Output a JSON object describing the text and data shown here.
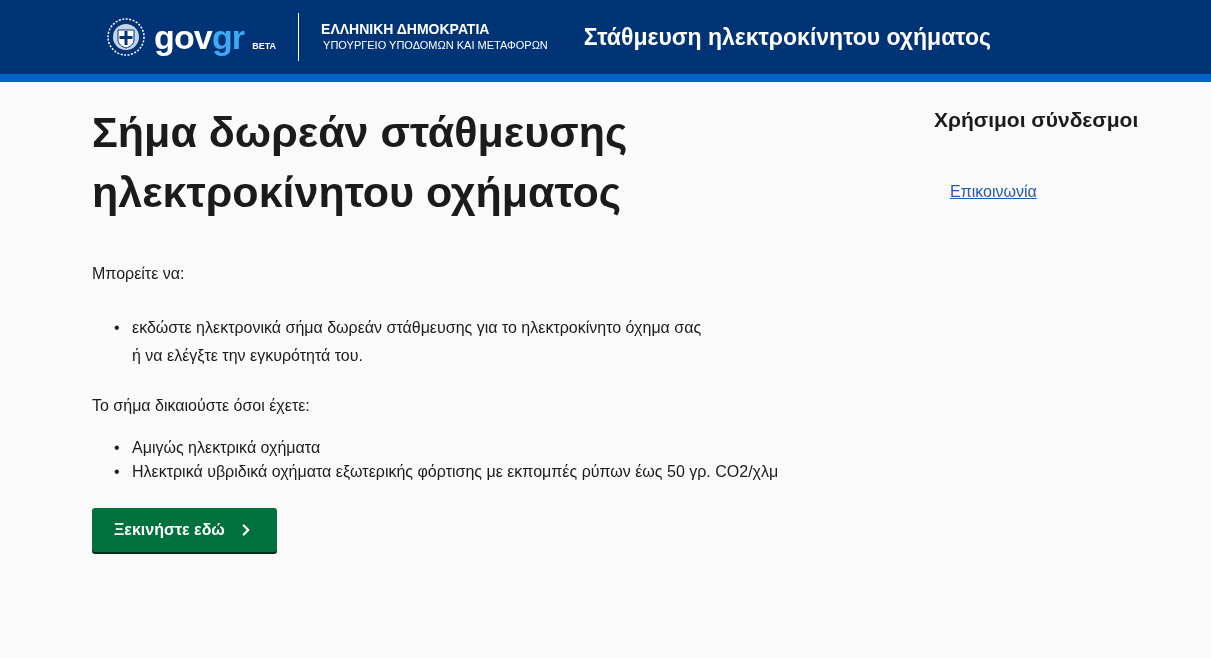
{
  "header": {
    "logo": {
      "part_1": "gov",
      "part_2": "gr",
      "badge": "BETA"
    },
    "org_title": "ΕΛΛΗΝΙΚΗ ΔΗΜΟΚΡΑΤΙΑ",
    "org_subtitle": "ΥΠΟΥΡΓΕΙΟ ΥΠΟΔΟΜΩΝ ΚΑΙ ΜΕΤΑΦΟΡΩΝ",
    "service_title": "Στάθμευση ηλεκτροκίνητου οχήματος"
  },
  "main": {
    "title": "Σήμα δωρεάν στάθμευσης ηλεκτροκίνητου οχήματος",
    "intro": "Μπορείτε να:",
    "bullet": "•",
    "intro_items": [
      "εκδώστε ηλεκτρονικά σήμα δωρεάν στάθμευσης για το ηλεκτροκίνητο όχημα σας ή να ελέγξτε την εγκυρότητά του."
    ],
    "eligibility": "Το σήμα δικαιούστε όσοι έχετε:",
    "eligibility_items": [
      "Αμιγώς ηλεκτρικά οχήματα",
      "Ηλεκτρικά υβριδικά οχήματα εξωτερικής φόρτισης με εκπομπές ρύπων έως 50 γρ. CO2/χλμ"
    ],
    "start_button": "Ξεκινήστε εδώ"
  },
  "sidebar": {
    "title": "Χρήσιμοι σύνδεσμοι",
    "links": [
      "Επικοινωνία"
    ]
  }
}
